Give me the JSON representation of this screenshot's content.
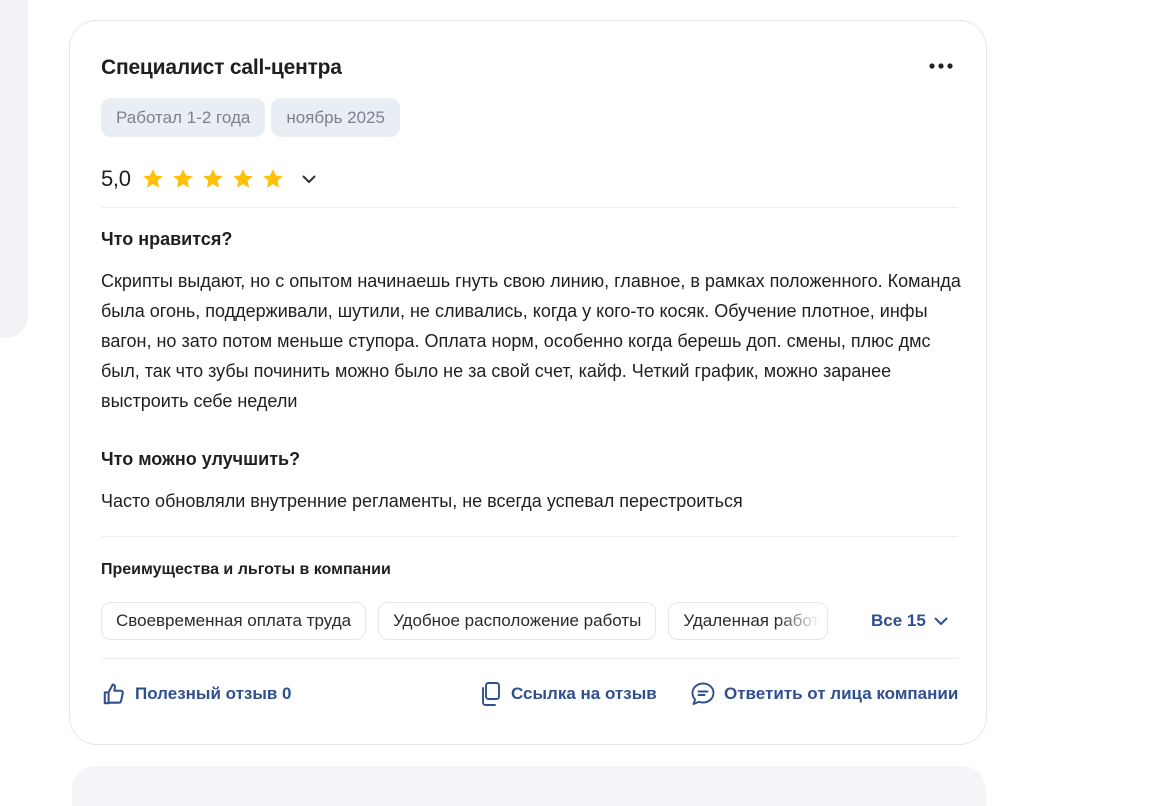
{
  "review": {
    "title": "Специалист call-центра",
    "tags": [
      "Работал 1-2 года",
      "ноябрь 2025"
    ],
    "rating": {
      "value": "5,0",
      "stars": 5,
      "max": 5
    },
    "likes": {
      "heading": "Что нравится?",
      "text": "Скрипты выдают, но с опытом начинаешь гнуть свою линию, главное, в рамках положенного. Команда была огонь, поддерживали, шутили, не сливались, когда у кого-то косяк. Обучение плотное, инфы вагон, но зато потом меньше ступора. Оплата норм, особенно когда берешь доп. смены, плюс дмс был, так что зубы починить можно было не за свой счет, кайф. Четкий график, можно заранее выстроить себе недели"
    },
    "improve": {
      "heading": "Что можно улучшить?",
      "text": "Часто обновляли внутренние регламенты, не всегда успевал перестроиться"
    },
    "benefits": {
      "heading": "Преимущества и льготы в компании",
      "items": [
        "Своевременная оплата труда",
        "Удобное расположение работы",
        "Удаленная работа"
      ],
      "all_label": "Все 15"
    },
    "actions": {
      "helpful": "Полезный отзыв 0",
      "link": "Ссылка на отзыв",
      "reply": "Ответить от лица компании"
    }
  },
  "colors": {
    "star": "#ffc107",
    "link": "#2f4f8f",
    "tag_bg": "#e9edf4",
    "tag_text": "#7a8290"
  }
}
